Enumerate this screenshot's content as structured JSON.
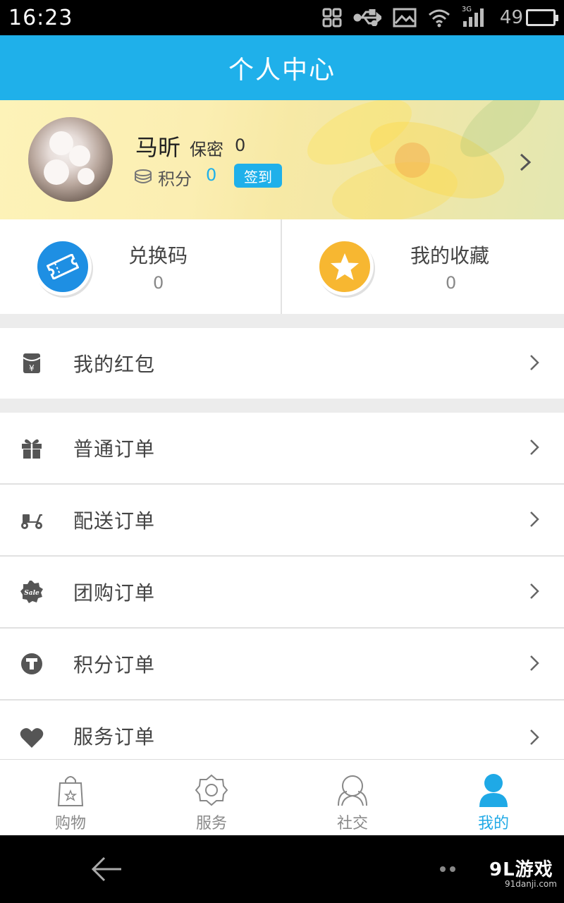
{
  "status_bar": {
    "time": "16:23",
    "signal_label": "3G",
    "battery_level": "49",
    "icons": [
      "qr-scan-icon",
      "usb-icon",
      "image-icon",
      "wifi-icon",
      "signal-3g-icon",
      "battery-icon"
    ],
    "battery_color": "#3ad12e"
  },
  "header": {
    "title": "个人中心",
    "color": "#1fb0ea"
  },
  "profile": {
    "name": "马昕",
    "gender": "保密",
    "age": "0",
    "points_label": "积分",
    "points_value": "0",
    "signin_label": "签到"
  },
  "stats": [
    {
      "label": "兑换码",
      "value": "0",
      "icon": "ticket-icon",
      "color": "#1e8fe3"
    },
    {
      "label": "我的收藏",
      "value": "0",
      "icon": "star-icon",
      "color": "#f7b731"
    }
  ],
  "menu": {
    "red_packet": {
      "label": "我的红包",
      "icon": "red-packet-icon"
    },
    "orders": [
      {
        "label": "普通订单",
        "icon": "gift-icon"
      },
      {
        "label": "配送订单",
        "icon": "scooter-icon"
      },
      {
        "label": "团购订单",
        "icon": "sale-badge-icon",
        "badge_text": "Sale"
      },
      {
        "label": "积分订单",
        "icon": "t-coin-icon"
      },
      {
        "label": "服务订单",
        "icon": "heart-icon"
      }
    ]
  },
  "tabbar": {
    "active": "我的",
    "active_color": "#1fa9e6",
    "tabs": [
      {
        "label": "购物",
        "icon": "shopping-bag-icon"
      },
      {
        "label": "服务",
        "icon": "service-gear-icon"
      },
      {
        "label": "社交",
        "icon": "social-icon"
      },
      {
        "label": "我的",
        "icon": "person-icon"
      }
    ]
  },
  "nav_bar": {
    "watermark": "9L游戏",
    "watermark_url": "91danji.com"
  }
}
